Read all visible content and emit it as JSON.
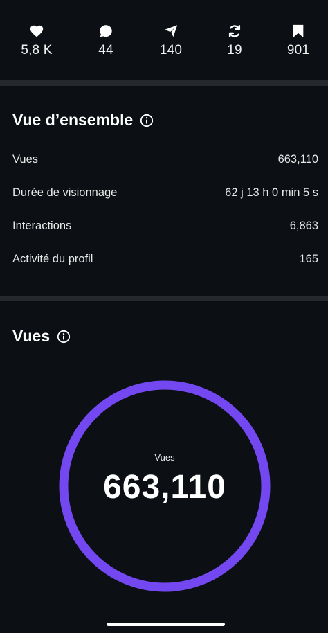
{
  "stats": [
    {
      "icon": "heart-icon",
      "value": "5,8 K"
    },
    {
      "icon": "comment-icon",
      "value": "44"
    },
    {
      "icon": "send-icon",
      "value": "140"
    },
    {
      "icon": "repost-icon",
      "value": "19"
    },
    {
      "icon": "bookmark-icon",
      "value": "901"
    }
  ],
  "overview": {
    "title": "Vue d’ensemble",
    "rows": [
      {
        "label": "Vues",
        "value": "663,110"
      },
      {
        "label": "Durée de visionnage",
        "value": "62 j 13 h 0 min 5 s"
      },
      {
        "label": "Interactions",
        "value": "6,863"
      },
      {
        "label": "Activité du profil",
        "value": "165"
      }
    ]
  },
  "views": {
    "title": "Vues",
    "ring_label": "Vues",
    "ring_value": "663,110",
    "ring_fraction": 1.0
  },
  "colors": {
    "background": "#0c1014",
    "divider": "#25292d",
    "ring": "#7448f0"
  }
}
